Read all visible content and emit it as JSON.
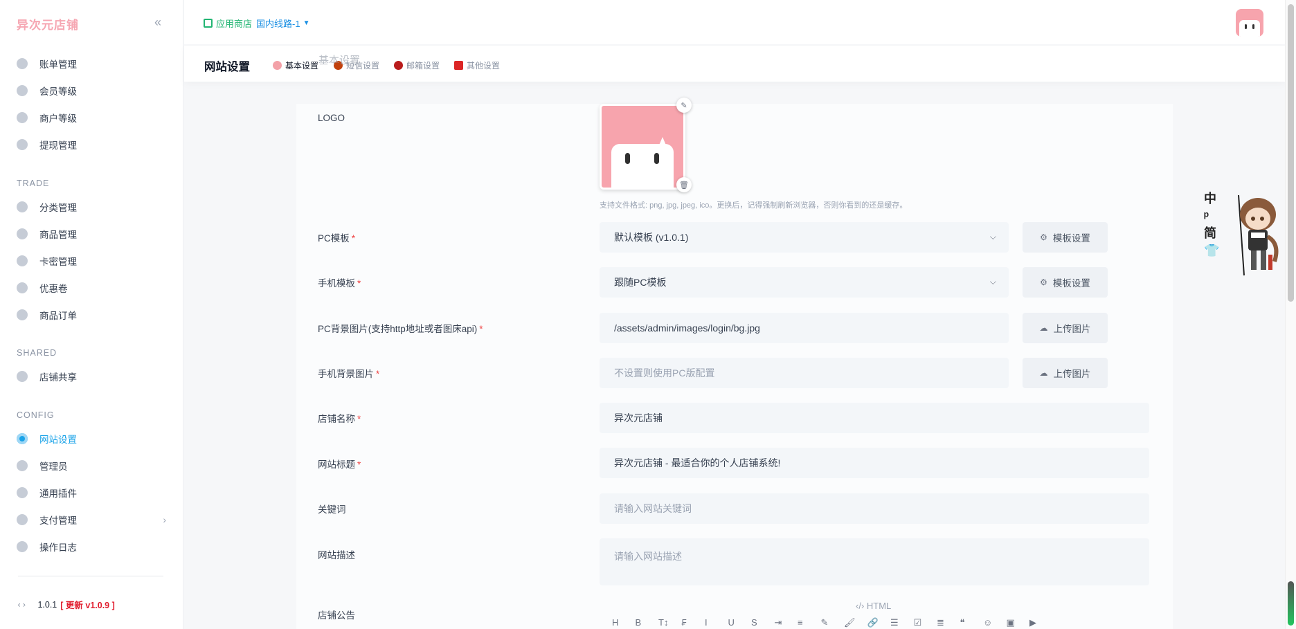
{
  "app": {
    "brand": "异次元店铺",
    "version": "1.0.1",
    "update_label": "[ 更新 v1.0.9 ]"
  },
  "sidebar": {
    "items_top": [
      {
        "label": "账单管理",
        "icon": "bill-icon"
      },
      {
        "label": "会员等级",
        "icon": "member-level-icon"
      },
      {
        "label": "商户等级",
        "icon": "merchant-level-icon"
      },
      {
        "label": "提现管理",
        "icon": "withdraw-icon"
      }
    ],
    "section_trade": "TRADE",
    "items_trade": [
      {
        "label": "分类管理",
        "icon": "category-icon"
      },
      {
        "label": "商品管理",
        "icon": "product-icon"
      },
      {
        "label": "卡密管理",
        "icon": "card-key-icon"
      },
      {
        "label": "优惠卷",
        "icon": "coupon-icon"
      },
      {
        "label": "商品订单",
        "icon": "order-icon"
      }
    ],
    "section_shared": "SHARED",
    "items_shared": [
      {
        "label": "店铺共享",
        "icon": "share-icon"
      }
    ],
    "section_config": "CONFIG",
    "items_config": [
      {
        "label": "网站设置",
        "icon": "settings-icon",
        "active": true
      },
      {
        "label": "管理员",
        "icon": "admin-icon"
      },
      {
        "label": "通用插件",
        "icon": "plugin-icon"
      },
      {
        "label": "支付管理",
        "icon": "payment-icon"
      },
      {
        "label": "操作日志",
        "icon": "log-icon"
      }
    ]
  },
  "topbar": {
    "store_label": "应用商店",
    "line_label": "国内线路-1"
  },
  "subheader": {
    "title": "网站设置",
    "ghost_title": "基本设置",
    "tabs": [
      "基本设置",
      "短信设置",
      "邮箱设置",
      "其他设置"
    ]
  },
  "form": {
    "logo_label": "LOGO",
    "logo_hint": "支持文件格式: png, jpg, jpeg, ico。更换后，记得强制刷新浏览器，否则你看到的还是缓存。",
    "pc_template_label": "PC模板",
    "pc_template_value": "默认模板 (v1.0.1)",
    "mobile_template_label": "手机模板",
    "mobile_template_value": "跟随PC模板",
    "template_settings_btn": "模板设置",
    "pc_bg_label": "PC背景图片(支持http地址或者图床api)",
    "pc_bg_value": "/assets/admin/images/login/bg.jpg",
    "mobile_bg_label": "手机背景图片",
    "mobile_bg_placeholder": "不设置则使用PC版配置",
    "upload_btn": "上传图片",
    "shop_name_label": "店铺名称",
    "shop_name_value": "异次元店铺",
    "site_title_label": "网站标题",
    "site_title_value": "异次元店铺 - 最适合你的个人店铺系统!",
    "keywords_label": "关键词",
    "keywords_placeholder": "请输入网站关键词",
    "description_label": "网站描述",
    "description_placeholder": "请输入网站描述",
    "notice_label": "店铺公告",
    "html_toggle": "HTML",
    "required_mark": "*"
  },
  "editor_tools": [
    "H",
    "B",
    "T↕",
    "₣",
    "I",
    "U",
    "S",
    "⇥",
    "≡",
    "✎",
    "🖌",
    "🔗",
    "☰",
    "☑",
    "≣",
    "❝",
    "☺",
    "▣",
    "▶"
  ],
  "mascot": {
    "side_labels": [
      "中",
      "ᵖ",
      "简",
      "👕"
    ]
  },
  "colors": {
    "accent": "#1aa3e8",
    "brand": "#f6a6b2",
    "required": "#ef4444",
    "store_green": "#22b573"
  }
}
